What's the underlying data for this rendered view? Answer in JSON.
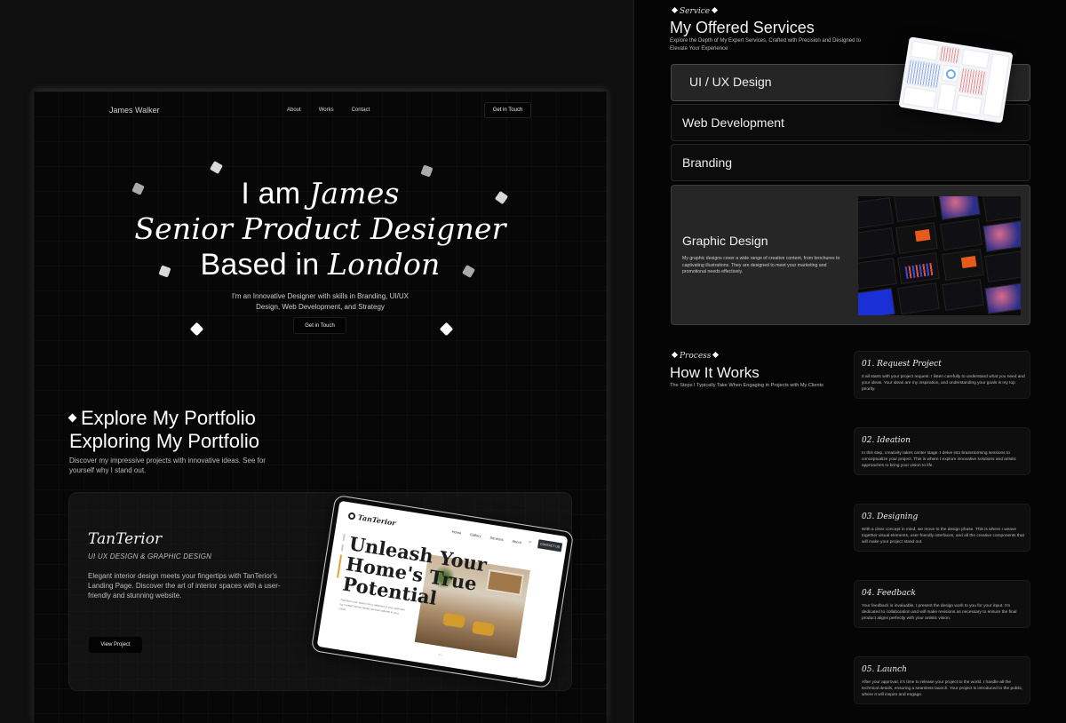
{
  "portfolio_page": {
    "nav": {
      "brand": "James Walker",
      "links": [
        "About",
        "Works",
        "Contact"
      ],
      "cta": "Get in Touch"
    },
    "hero": {
      "line1_plain": "I am ",
      "line1_italic": "James",
      "line2_italic": "Senior Product Designer",
      "line3_plain": "Based in ",
      "line3_italic": "London",
      "subtitle_line1": "I'm an Innovative Designer with skills in Branding, UI/UX",
      "subtitle_line2": "Design, Web Development, and Strategy",
      "cta": "Get in Touch"
    },
    "portfolio": {
      "title1": "Explore My Portfolio",
      "title2": "Exploring My Portfolio",
      "description": "Discover my impressive projects with innovative ideas. See for yourself why I stand out."
    },
    "project": {
      "title": "TanTerior",
      "subtitle": "UI UX DESIGN & GRAPHIC DESIGN",
      "description": "Elegant interior design meets your fingertips with TanTerior's Landing Page. Discover the art of interior spaces with a user-friendly and stunning website.",
      "button": "View Project",
      "mockup": {
        "logo": "TanTerior",
        "nav": [
          "Home",
          "Gallery",
          "Services",
          "About"
        ],
        "contact": "CONTACT US",
        "headline": [
          "Unleash Your",
          "Home's True",
          "Potential"
        ],
        "body": "Transform your space into a reflection of your style with our curated interior design services tailored to your vision."
      }
    }
  },
  "services": {
    "tag": "Service",
    "title": "My Offered Services",
    "description": "Explore the Depth of My Expert Services, Crafted with Precision and Designed to Elevate Your Experience",
    "items": [
      {
        "label": "UI / UX Design"
      },
      {
        "label": "Web Development"
      },
      {
        "label": "Branding"
      },
      {
        "label": "Graphic Design",
        "description": "My graphic designs cover a wide range of creative content, from brochures to captivating illustrations. They are designed to meet your marketing and promotional needs effectively."
      }
    ]
  },
  "process": {
    "tag": "Process",
    "title": "How It Works",
    "description": "The Steps I Typically Take When Engaging in Projects with My Clients",
    "steps": [
      {
        "title": "01.  Request Project",
        "description": "It all starts with your project request. I listen carefully to understand what you need and your ideas. Your ideas are my inspiration, and understanding your goals is my top priority."
      },
      {
        "title": "02.  Ideation",
        "description": "In this step, creativity takes center stage. I delve into brainstorming sessions to conceptualize your project. This is where I explore innovative solutions and artistic approaches to bring your vision to life."
      },
      {
        "title": "03.  Designing",
        "description": "With a clear concept in mind, we move to the design phase. This is where I weave together visual elements, user-friendly interfaces, and all the creative components that will make your project stand out."
      },
      {
        "title": "04.  Feedback",
        "description": "Your feedback is invaluable. I present the design work to you for your input. I'm dedicated to collaboration and will make revisions as necessary to ensure the final product aligns perfectly with your artistic vision."
      },
      {
        "title": "05.  Launch",
        "description": "After your approval, it's time to release your project to the world. I handle all the technical details, ensuring a seamless launch. Your project is introduced to the public, where it will inspire and engage."
      }
    ]
  }
}
